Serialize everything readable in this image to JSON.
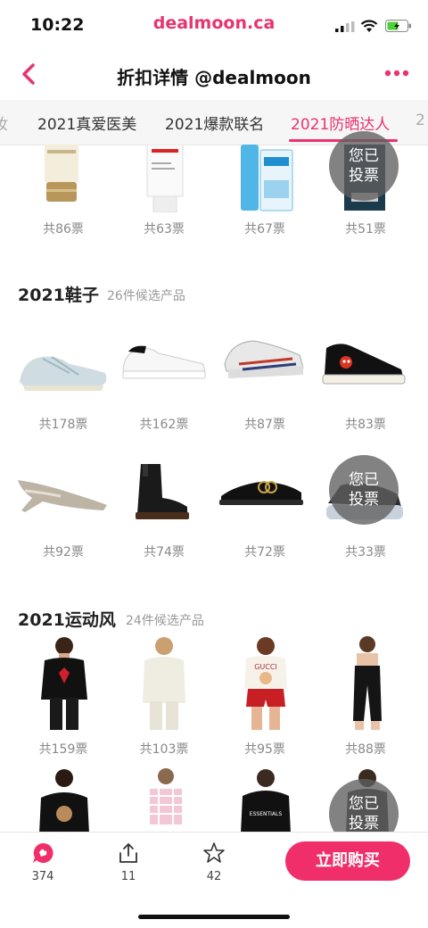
{
  "status": {
    "time": "10:22",
    "domain": "dealmoon.ca"
  },
  "nav": {
    "title": "折扣详情 @dealmoon"
  },
  "tabs": [
    {
      "label": "妆",
      "active": false
    },
    {
      "label": "2021真爱医美",
      "active": false
    },
    {
      "label": "2021爆款联名",
      "active": false
    },
    {
      "label": "2021防晒达人",
      "active": true
    },
    {
      "label": "2",
      "active": false
    }
  ],
  "sunscreen": {
    "votes": [
      "共86票",
      "共63票",
      "共67票",
      "共51票"
    ],
    "voted_badge": "您已投票"
  },
  "shoes": {
    "title": "2021鞋子",
    "count": "26件候选产品",
    "row1_votes": [
      "共178票",
      "共162票",
      "共87票",
      "共83票"
    ],
    "row2_votes": [
      "共92票",
      "共74票",
      "共72票",
      "共33票"
    ],
    "voted_badge": "您已投票"
  },
  "sport": {
    "title": "2021运动风",
    "count": "24件候选产品",
    "row1_votes": [
      "共159票",
      "共103票",
      "共95票",
      "共88票"
    ],
    "voted_badge": "您已投票",
    "row2_print_text": "ESSENTIALS",
    "row2_brand_text": "GUCCI"
  },
  "bottom": {
    "comments": "374",
    "shares": "11",
    "favorites": "42",
    "buy_label": "立即购买"
  },
  "colors": {
    "accent": "#e8336f",
    "buy": "#f02f6a"
  }
}
